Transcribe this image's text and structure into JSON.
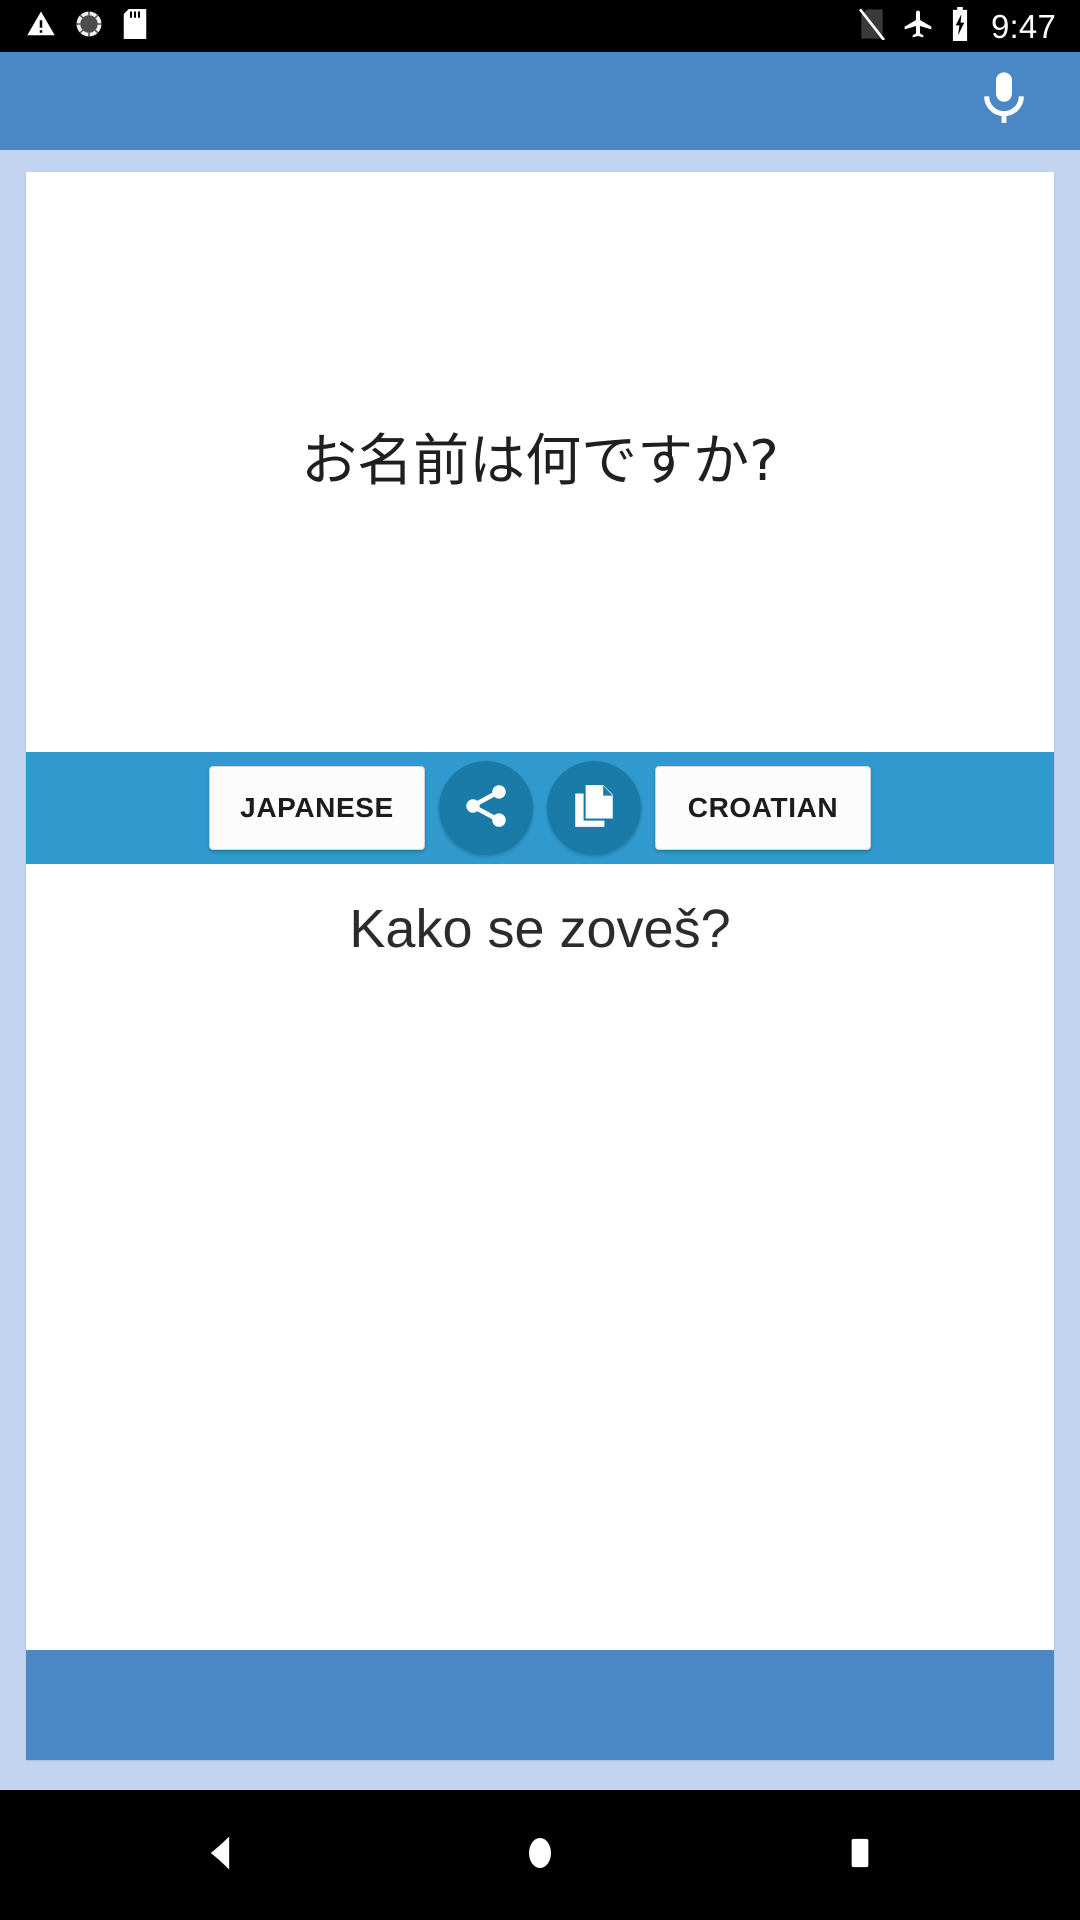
{
  "status_bar": {
    "icons_left": [
      "warning-triangle-icon",
      "gps-searching-icon",
      "sd-card-icon"
    ],
    "icons_right": [
      "no-sim-icon",
      "airplane-mode-icon",
      "battery-charging-icon"
    ],
    "clock": "9:47"
  },
  "app_bar": {
    "mic_icon": "microphone-icon",
    "background_color": "#4a87c5"
  },
  "translator": {
    "source_text": "お名前は何ですか?",
    "target_text": "Kako se zoveš?",
    "source_language": "JAPANESE",
    "target_language": "CROATIAN",
    "share_icon": "share-icon",
    "copy_icon": "copy-icon",
    "control_bar_color": "#309ace",
    "round_button_color": "#1b7ba8"
  },
  "nav_bar": {
    "back": "back-triangle-icon",
    "home": "home-circle-icon",
    "recents": "recents-square-icon"
  }
}
